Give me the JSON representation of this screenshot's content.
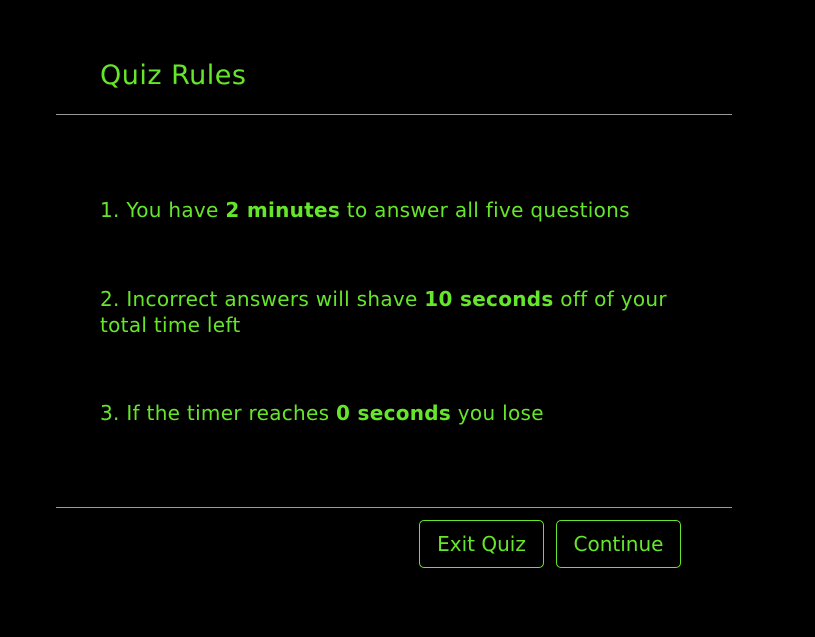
{
  "dialog": {
    "title": "Quiz Rules"
  },
  "rules": [
    {
      "number": "1.",
      "before": "You have",
      "highlight": "2 minutes",
      "after": "to answer all five questions"
    },
    {
      "number": "2.",
      "before": "Incorrect answers will shave",
      "highlight": "10 seconds",
      "after": "off of your total time left"
    },
    {
      "number": "3.",
      "before": "If the timer reaches",
      "highlight": "0 seconds",
      "after": "you lose"
    }
  ],
  "buttons": {
    "exit_label": "Exit Quiz",
    "continue_label": "Continue"
  },
  "colors": {
    "accent": "#66e62a",
    "background": "#000000",
    "divider": "#9a9a9a"
  }
}
